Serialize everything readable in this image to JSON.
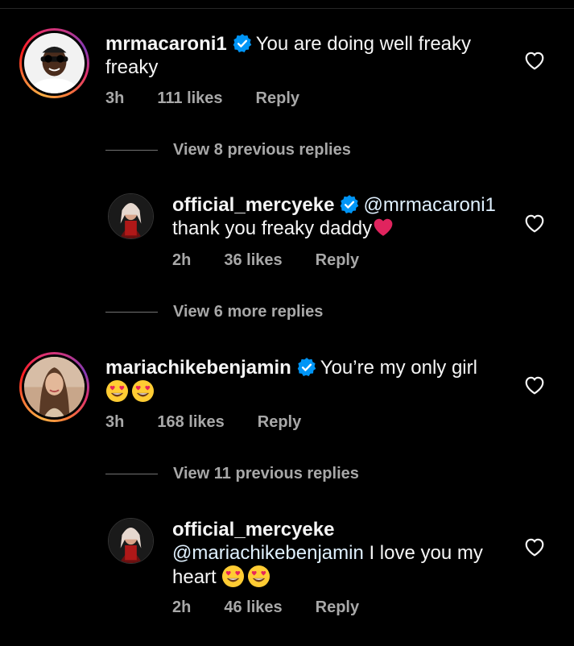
{
  "comments": [
    {
      "username": "mrmacaroni1",
      "text_line1": "You are doing well freaky",
      "text_line2": "freaky",
      "time": "3h",
      "likes": "111 likes",
      "reply": "Reply"
    },
    {
      "username": "official_mercyeke",
      "mention": "@mrmacaroni1",
      "text_line2": "thank you freaky daddy",
      "time": "2h",
      "likes": "36 likes",
      "reply": "Reply"
    },
    {
      "username": "mariachikebenjamin",
      "text_line1": "You’re my only girl",
      "time": "3h",
      "likes": "168 likes",
      "reply": "Reply"
    },
    {
      "username": "official_mercyeke",
      "mention": "@mariachikebenjamin",
      "text_line2_rest": "I love you my",
      "text_line3": "heart",
      "time": "2h",
      "likes": "46 likes",
      "reply": "Reply"
    }
  ],
  "view_replies": [
    "View 8 previous replies",
    "View 6 more replies",
    "View 11 previous replies"
  ],
  "colors": {
    "background": "#000000",
    "text": "#f5f5f5",
    "meta": "#a8a8a8",
    "verified": "#0095f6",
    "mention": "#e0f1ff"
  },
  "icons": [
    "verified-badge-icon",
    "heart-outline-icon",
    "red-heart-emoji",
    "heart-eyes-emoji"
  ]
}
